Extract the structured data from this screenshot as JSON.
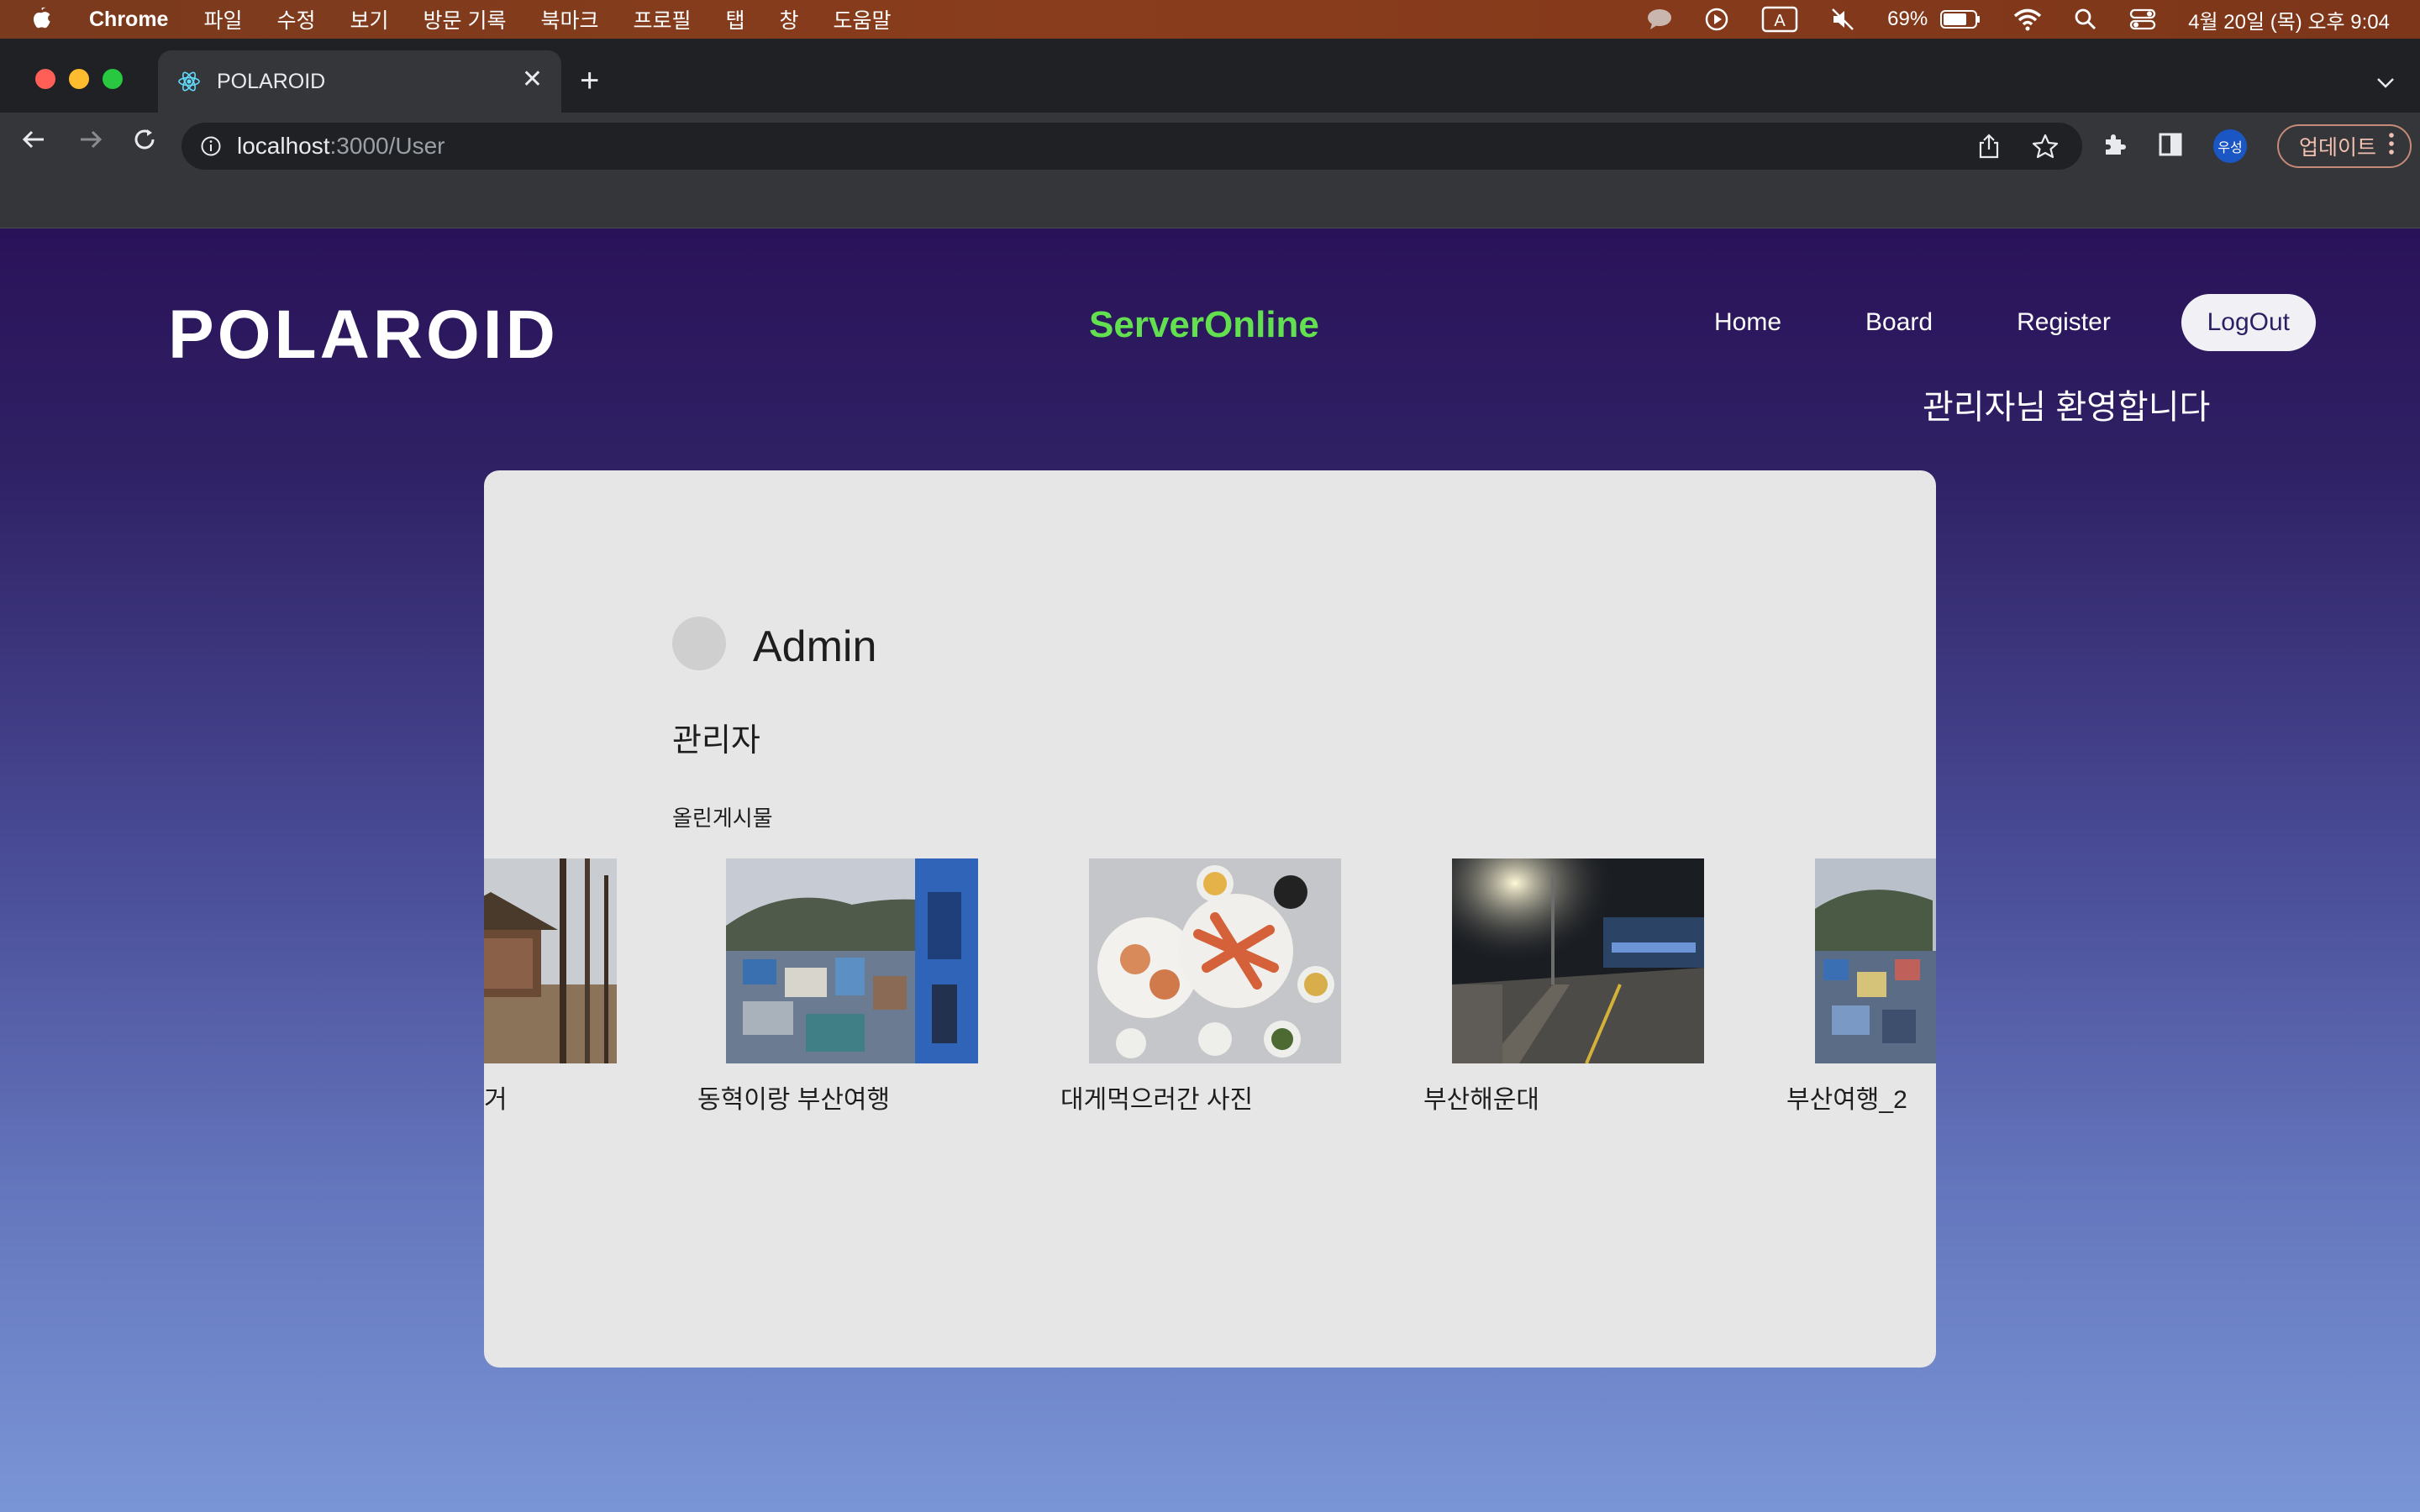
{
  "menubar": {
    "app": "Chrome",
    "items": [
      "파일",
      "수정",
      "보기",
      "방문 기록",
      "북마크",
      "프로필",
      "탭",
      "창",
      "도움말"
    ],
    "battery": "69%",
    "datetime": "4월 20일 (목) 오후 9:04"
  },
  "browser": {
    "tab_title": "POLAROID",
    "url_host": "localhost",
    "url_path": ":3000/User",
    "profile_label": "우성",
    "update_label": "업데이트"
  },
  "site": {
    "logo": "POLAROID",
    "server_status": "ServerOnline",
    "nav": {
      "home": "Home",
      "board": "Board",
      "register": "Register",
      "logout": "LogOut"
    },
    "welcome": "관리자님 환영합니다"
  },
  "profile": {
    "name": "Admin",
    "role": "관리자",
    "posts_label": "올린게시물",
    "posts": [
      {
        "caption": "거"
      },
      {
        "caption": "동혁이랑 부산여행"
      },
      {
        "caption": "대게먹으러간 사진"
      },
      {
        "caption": "부산해운대"
      },
      {
        "caption": "부산여행_2"
      }
    ]
  },
  "colors": {
    "server_status": "#63e04f",
    "scrollbar": "#7ad34b",
    "card": "#e6e6e6"
  }
}
